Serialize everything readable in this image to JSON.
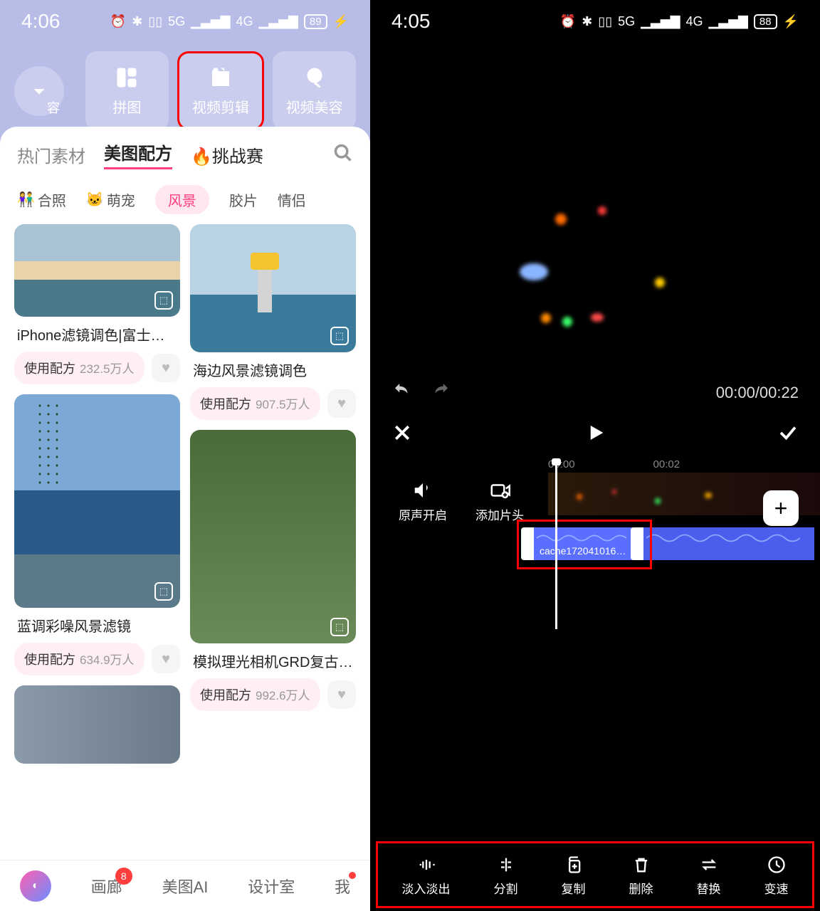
{
  "left": {
    "status": {
      "time": "4:06",
      "battery": "89",
      "signal1": "5G",
      "signal2": "4G"
    },
    "nav": {
      "more_label": "容",
      "puzzle": "拼图",
      "video_edit": "视频剪辑",
      "video_beauty": "视频美容"
    },
    "tabs": {
      "hot": "热门素材",
      "recipe": "美图配方",
      "challenge": "挑战赛"
    },
    "chips": {
      "group": "合照",
      "pet": "萌宠",
      "scenery": "风景",
      "film": "胶片",
      "couple": "情侣"
    },
    "cards": [
      {
        "title": "iPhone滤镜调色|富士…",
        "use": "使用配方",
        "count": "232.5万人"
      },
      {
        "title": "海边风景滤镜调色",
        "use": "使用配方",
        "count": "907.5万人"
      },
      {
        "title": "蓝调彩噪风景滤镜",
        "use": "使用配方",
        "count": "634.9万人"
      },
      {
        "title": "模拟理光相机GRD复古…",
        "use": "使用配方",
        "count": "992.6万人"
      }
    ],
    "bottom": {
      "gallery": "画廊",
      "ai": "美图AI",
      "studio": "设计室",
      "me": "我",
      "badge": "8"
    }
  },
  "right": {
    "status": {
      "time": "4:05",
      "battery": "88",
      "signal1": "5G",
      "signal2": "4G"
    },
    "timecode": "00:00/00:22",
    "marks": {
      "t0": "00:00",
      "t1": "00:02"
    },
    "side": {
      "sound": "原声开启",
      "addclip": "添加片头"
    },
    "audio_label": "cache172041016…",
    "tools": {
      "fade": "淡入淡出",
      "split": "分割",
      "copy": "复制",
      "delete": "删除",
      "replace": "替换",
      "speed": "变速"
    }
  }
}
